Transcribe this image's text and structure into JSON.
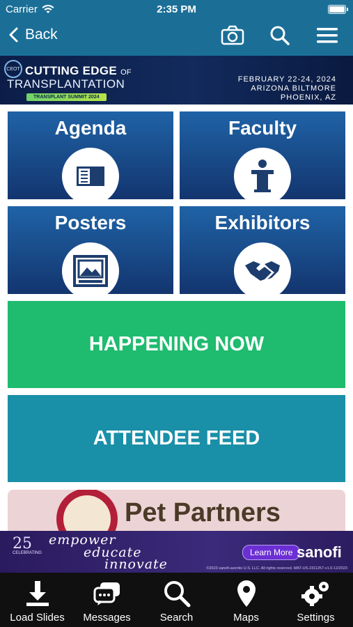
{
  "status_bar": {
    "carrier": "Carrier",
    "time": "2:35 PM"
  },
  "navbar": {
    "back_label": "Back",
    "icons": [
      "camera-icon",
      "search-icon",
      "menu-icon"
    ]
  },
  "banner": {
    "badge": "CEOT",
    "title_line1": "CUTTING EDGE",
    "title_of": "OF",
    "title_line2": "TRANSPLANTATION",
    "subtitle": "TRANSPLANT SUMMIT 2024",
    "dates": "FEBRUARY 22-24, 2024",
    "venue": "ARIZONA BILTMORE",
    "city": "PHOENIX, AZ"
  },
  "tiles": [
    {
      "label": "Agenda",
      "icon": "book-icon"
    },
    {
      "label": "Faculty",
      "icon": "podium-icon"
    },
    {
      "label": "Posters",
      "icon": "poster-icon"
    },
    {
      "label": "Exhibitors",
      "icon": "handshake-icon"
    }
  ],
  "buttons": {
    "happening_now": "HAPPENING NOW",
    "attendee_feed": "ATTENDEE FEED"
  },
  "ad": {
    "sponsor": "Pet Partners"
  },
  "promo": {
    "anniversary": "25",
    "anniversary_caption": "CELEBRATING",
    "line1": "empower",
    "line2": "educate",
    "line3": "innovate",
    "cta": "Learn More",
    "brand": "sanofi",
    "fine_print": "©2023 sanofi-aventis U.S. LLC. All rights reserved. MAT-US-2311257-v1.0-12/2023"
  },
  "tabbar": [
    {
      "label": "Load Slides",
      "icon": "download-icon"
    },
    {
      "label": "Messages",
      "icon": "messages-icon"
    },
    {
      "label": "Search",
      "icon": "search-icon"
    },
    {
      "label": "Maps",
      "icon": "map-pin-icon"
    },
    {
      "label": "Settings",
      "icon": "gear-icon"
    }
  ],
  "colors": {
    "header": "#1b6f97",
    "tile_top": "#1f63a6",
    "tile_bottom": "#13356f",
    "happening_now": "#1fbb6e",
    "attendee_feed": "#1a8fa8",
    "tabbar": "#101010"
  }
}
